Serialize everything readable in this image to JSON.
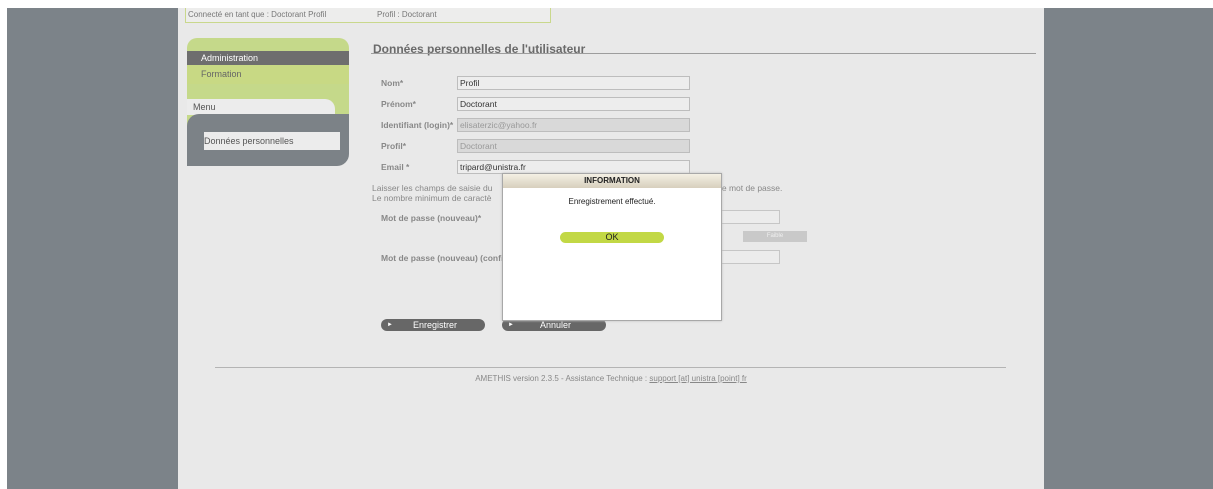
{
  "header": {
    "connected_as": "Connecté en tant que : Doctorant Profil",
    "profile": "Profil : Doctorant"
  },
  "sidebar": {
    "tabs": [
      {
        "label": "Administration"
      },
      {
        "label": "Formation"
      }
    ],
    "menu_label": "Menu",
    "items": [
      {
        "label": "Données personnelles"
      }
    ]
  },
  "main": {
    "title": "Données personnelles de l'utilisateur",
    "fields": {
      "nom": {
        "label": "Nom*",
        "value": "Profil"
      },
      "prenom": {
        "label": "Prénom*",
        "value": "Doctorant"
      },
      "identifiant": {
        "label": "Identifiant (login)*",
        "value": "elisaterzic@yahoo.fr"
      },
      "profil": {
        "label": "Profil*",
        "value": "Doctorant"
      },
      "email": {
        "label": "Email *",
        "value": "tripard@unistra.fr"
      }
    },
    "note_line1_start": "Laisser les champs de saisie du",
    "note_line1_end": "le mot de passe.",
    "note_line2": "Le nombre minimum de caractè",
    "password_new_label": "Mot de passe (nouveau)*",
    "password_confirm_label": "Mot de passe (nouveau) (confi",
    "password_strength": "Faible",
    "save_button": "Enregistrer",
    "cancel_button": "Annuler"
  },
  "footer": {
    "text": "AMETHIS version 2.3.5 - Assistance Technique :",
    "link": "support [at] unistra [point] fr"
  },
  "modal": {
    "title": "INFORMATION",
    "message": "Enregistrement effectué.",
    "ok_label": "OK"
  },
  "colors": {
    "accent_green": "#c5d98a",
    "ok_button": "#c2d845",
    "dark_gray": "#6e6e6e",
    "side_gray": "#7c8389"
  }
}
